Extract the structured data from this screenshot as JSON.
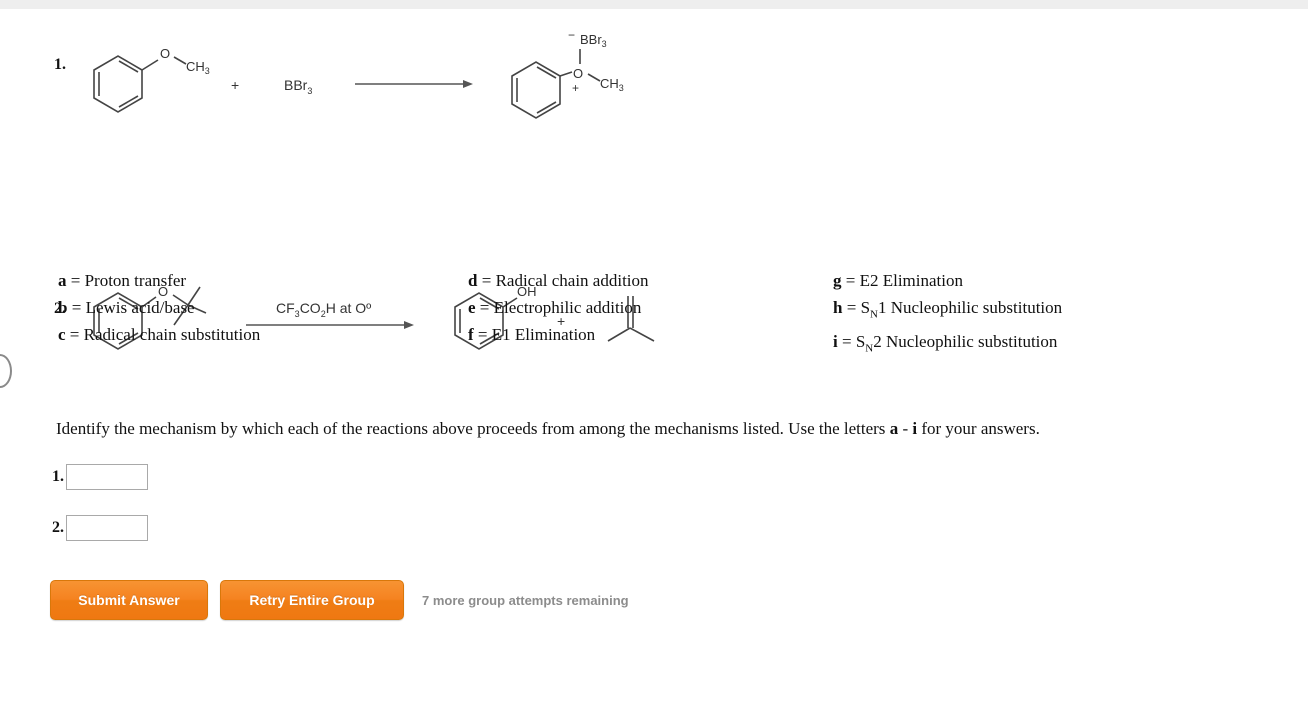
{
  "reactions": [
    {
      "number": "1.",
      "reactant_name": "anisole (methoxybenzene)",
      "reactant_o_label": "O",
      "reactant_ch3_label": "CH",
      "reactant_ch3_sub": "3",
      "plus": "+",
      "reagent": "BBr",
      "reagent_sub": "3",
      "arrow_condition": "",
      "product_name": "anisole-boron tribromide complex",
      "product_bbr3_label": "BBr",
      "product_bbr3_sub": "3",
      "product_minus_charge": "−",
      "product_o_label": "O",
      "product_plus_charge": "+",
      "product_ch3_label": "CH",
      "product_ch3_sub": "3"
    },
    {
      "number": "2.",
      "reactant_name": "tert-butyl phenyl ether",
      "reactant_o_label": "O",
      "arrow_condition_pre": "CF",
      "arrow_condition_sub1": "3",
      "arrow_condition_mid": "CO",
      "arrow_condition_sub2": "2",
      "arrow_condition_post": "H at Oº",
      "product1_name": "phenol",
      "product1_oh_label": "OH",
      "plus": "+",
      "product2_name": "2-methylpropene (isobutylene)"
    }
  ],
  "mechanism_key": {
    "columns": [
      [
        {
          "letter": "a",
          "eq": " = ",
          "label": "Proton transfer"
        },
        {
          "letter": "b",
          "eq": " = ",
          "label": "Lewis acid/base"
        },
        {
          "letter": "c",
          "eq": " = ",
          "label": "Radical chain substitution"
        }
      ],
      [
        {
          "letter": "d",
          "eq": " = ",
          "label": "Radical chain addition"
        },
        {
          "letter": "e",
          "eq": " = ",
          "label": "Electrophilic addition"
        },
        {
          "letter": "f",
          "eq": " = ",
          "label": "E1 Elimination"
        }
      ],
      [
        {
          "letter": "g",
          "eq": " = ",
          "label": "E2 Elimination"
        },
        {
          "letter": "h",
          "eq": " = ",
          "label": "S",
          "sub": "N",
          "label_tail": "1 Nucleophilic substitution"
        },
        {
          "letter": "i",
          "eq": " = ",
          "label": "S",
          "sub": "N",
          "label_tail": "2 Nucleophilic substitution"
        }
      ]
    ]
  },
  "instruction": {
    "part1": "Identify the mechanism by which each of the reactions above proceeds from among the mechanisms listed. Use the letters ",
    "letter_a": "a",
    "dash": " - ",
    "letter_i": "i",
    "part2": " for your answers."
  },
  "answers": [
    {
      "label": "1.",
      "value": "",
      "placeholder": ""
    },
    {
      "label": "2.",
      "value": "",
      "placeholder": ""
    }
  ],
  "footer": {
    "submit_label": "Submit Answer",
    "retry_label": "Retry Entire Group",
    "attempts_text": "7 more group attempts remaining"
  },
  "colors": {
    "button_orange": "#f58220",
    "button_border": "#d9770a",
    "attempts_gray": "#8c8c8c",
    "bond_gray": "#444444",
    "input_border": "#a9a9a9",
    "top_strip": "#eeeeee"
  }
}
